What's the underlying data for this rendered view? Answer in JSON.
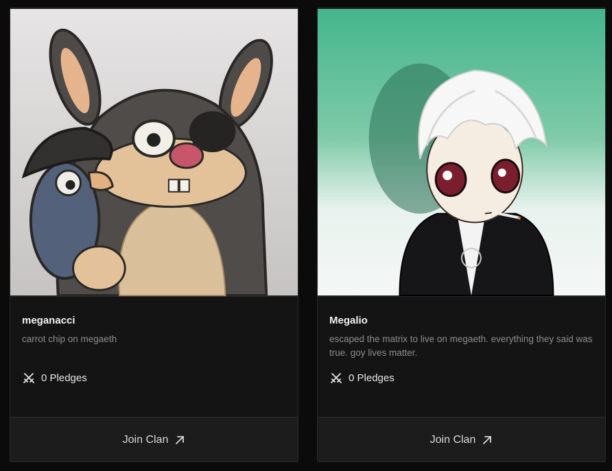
{
  "cards": [
    {
      "title": "meganacci",
      "description": "carrot chip on megaeth",
      "pledges_label": "0 Pledges",
      "join_label": "Join Clan",
      "image_icon": "rabbit-pirate-avatar"
    },
    {
      "title": "Megalio",
      "description": "escaped the matrix to live on megaeth. everything they said was true. goy lives matter.",
      "pledges_label": "0 Pledges",
      "join_label": "Join Clan",
      "image_icon": "anime-character-avatar"
    }
  ],
  "icons": {
    "pledge": "crossed-swords-icon",
    "join": "arrow-up-right-icon"
  },
  "colors": {
    "background": "#0b0b0b",
    "card": "#161616",
    "footer": "#1c1c1c",
    "muted_text": "#8d8d8d",
    "image1_bg": "#e2e0e0",
    "image2_bg": "#4bb690"
  }
}
